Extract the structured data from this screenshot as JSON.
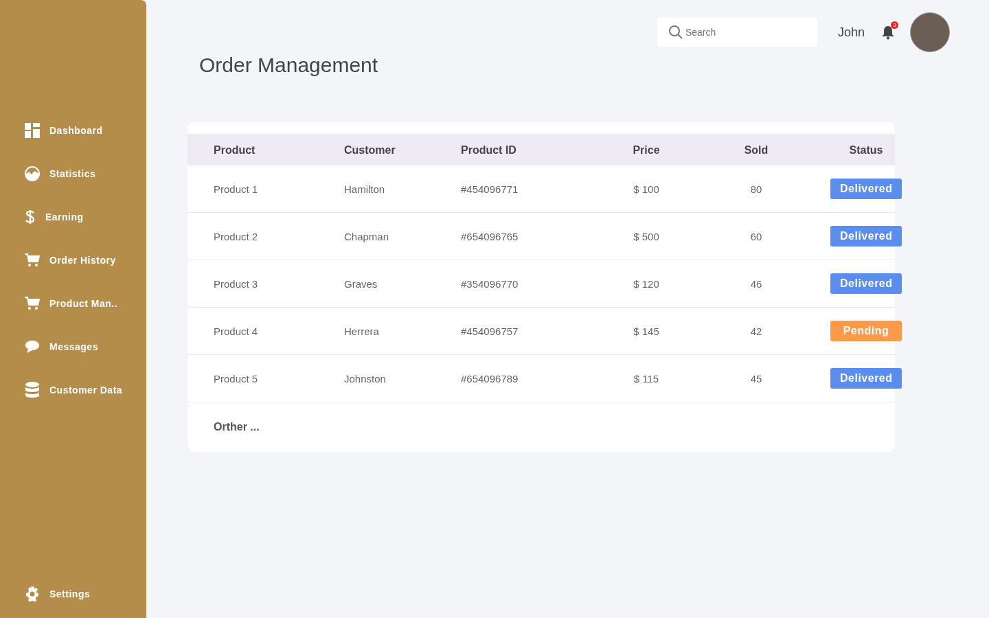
{
  "sidebar": {
    "items": [
      "Dashboard",
      "Statistics",
      "Earning",
      "Order History",
      "Product Man..",
      "Messages",
      "Customer Data"
    ],
    "settings": "Settings"
  },
  "header": {
    "search": {
      "placeholder": "Search"
    },
    "user_name": "John",
    "notification_count": "3"
  },
  "page_title": "Order Management",
  "table": {
    "columns": [
      "Product",
      "Customer",
      "Product ID",
      "Price",
      "Sold",
      "Status"
    ],
    "rows": [
      {
        "product": "Product 1",
        "customer": "Hamilton",
        "product_id": "#454096771",
        "price": "$ 100",
        "sold": "80",
        "status": {
          "label": "Delivered",
          "color": "#5b8def"
        }
      },
      {
        "product": "Product 2",
        "customer": "Chapman",
        "product_id": "#654096765",
        "price": "$ 500",
        "sold": "60",
        "status": {
          "label": "Delivered",
          "color": "#5b8def"
        }
      },
      {
        "product": "Product 3",
        "customer": "Graves",
        "product_id": "#354096770",
        "price": "$ 120",
        "sold": "46",
        "status": {
          "label": "Delivered",
          "color": "#5b8def"
        }
      },
      {
        "product": "Product 4",
        "customer": "Herrera",
        "product_id": "#454096757",
        "price": "$ 145",
        "sold": "42",
        "status": {
          "label": "Pending",
          "color": "#fd9a4a"
        }
      },
      {
        "product": "Product 5",
        "customer": "Johnston",
        "product_id": "#654096789",
        "price": "$ 115",
        "sold": "45",
        "status": {
          "label": "Delivered",
          "color": "#5b8def"
        }
      }
    ],
    "footer": "Orther ..."
  }
}
